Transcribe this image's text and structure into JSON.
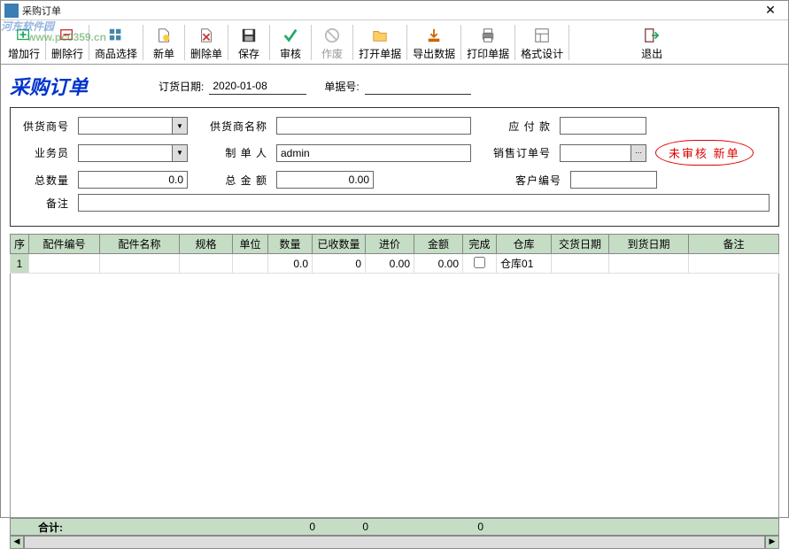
{
  "window": {
    "title": "采购订单"
  },
  "watermark": {
    "main": "河东软件园",
    "sub": "www.pc0359.cn"
  },
  "toolbar": {
    "add_row": "增加行",
    "del_row": "删除行",
    "goods_select": "商品选择",
    "new_doc": "新单",
    "del_doc": "删除单",
    "save": "保存",
    "audit": "审核",
    "void": "作废",
    "open_doc": "打开单据",
    "export": "导出数据",
    "print": "打印单据",
    "format": "格式设计",
    "exit": "退出"
  },
  "header": {
    "title": "采购订单",
    "date_label": "订货日期:",
    "date_value": "2020-01-08",
    "docno_label": "单据号:",
    "docno_value": ""
  },
  "form": {
    "supplier_no_label": "供货商号",
    "supplier_no": "",
    "supplier_name_label": "供货商名称",
    "supplier_name": "",
    "payable_label": "应 付 款",
    "payable": "",
    "clerk_label": "业务员",
    "clerk": "",
    "maker_label": "制 单 人",
    "maker": "admin",
    "sales_order_label": "销售订单号",
    "sales_order": "",
    "total_qty_label": "总数量",
    "total_qty": "0.0",
    "total_amt_label": "总 金 额",
    "total_amt": "0.00",
    "cust_no_label": "客户编号",
    "cust_no": "",
    "remark_label": "备注",
    "remark": "",
    "status": "未审核  新单"
  },
  "columns": {
    "seq": "序",
    "part_no": "配件编号",
    "part_name": "配件名称",
    "spec": "规格",
    "unit": "单位",
    "qty": "数量",
    "recv_qty": "已收数量",
    "price": "进价",
    "amount": "金额",
    "done": "完成",
    "warehouse": "仓库",
    "delivery_date": "交货日期",
    "arrival_date": "到货日期",
    "remark": "备注"
  },
  "rows": [
    {
      "seq": "1",
      "part_no": "",
      "part_name": "",
      "spec": "",
      "unit": "",
      "qty": "0.0",
      "recv_qty": "0",
      "price": "0.00",
      "amount": "0.00",
      "done": false,
      "warehouse": "仓库01",
      "delivery_date": "",
      "arrival_date": "",
      "remark": ""
    }
  ],
  "summary": {
    "label": "合计:",
    "qty": "0",
    "recv_qty": "0",
    "amount": "0"
  }
}
